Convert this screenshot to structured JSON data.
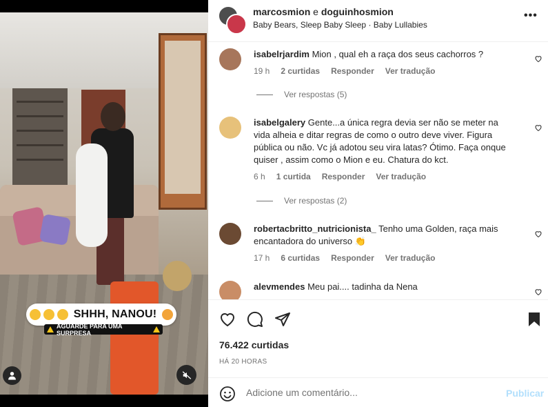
{
  "video": {
    "sticker_text": "SHHH, NANOU!",
    "sticker_subtext": "AGUARDE PARA UMA SURPRESA"
  },
  "header": {
    "user1": "marcosmion",
    "joiner": "e",
    "user2": "doguinhosmion",
    "audio": "Baby Bears, Sleep Baby Sleep · Baby Lullabies",
    "more": "•••"
  },
  "comments": [
    {
      "user": "isabelrjardim",
      "text": "Mion , qual eh a raça dos seus cachorros ?",
      "time": "19 h",
      "likes": "2 curtidas",
      "reply": "Responder",
      "translate": "Ver tradução",
      "view_replies": "Ver respostas (5)",
      "avatar_color": "#a7765b"
    },
    {
      "user": "isabelgalery",
      "text": "Gente...a única regra devia ser não se meter na vida alheia e ditar regras de como o outro deve viver. Figura pública ou não. Vc já adotou seu vira latas? Ótimo. Faça onque quiser , assim como o Mion e eu. Chatura do kct.",
      "time": "6 h",
      "likes": "1 curtida",
      "reply": "Responder",
      "translate": "Ver tradução",
      "view_replies": "Ver respostas (2)",
      "avatar_color": "#e7c17a"
    },
    {
      "user": "robertacbritto_nutricionista_",
      "text": "Tenho uma Golden, raça mais encantadora do universo 👏",
      "time": "17 h",
      "likes": "6 curtidas",
      "reply": "Responder",
      "translate": "Ver tradução",
      "avatar_color": "#6b4a33"
    },
    {
      "user": "alevmendes",
      "text": "Meu pai.... tadinha da Nena",
      "avatar_color": "#c98d66"
    }
  ],
  "post": {
    "likes": "76.422 curtidas",
    "time": "HÁ 20 HORAS",
    "comment_placeholder": "Adicione um comentário...",
    "post_button": "Publicar"
  }
}
